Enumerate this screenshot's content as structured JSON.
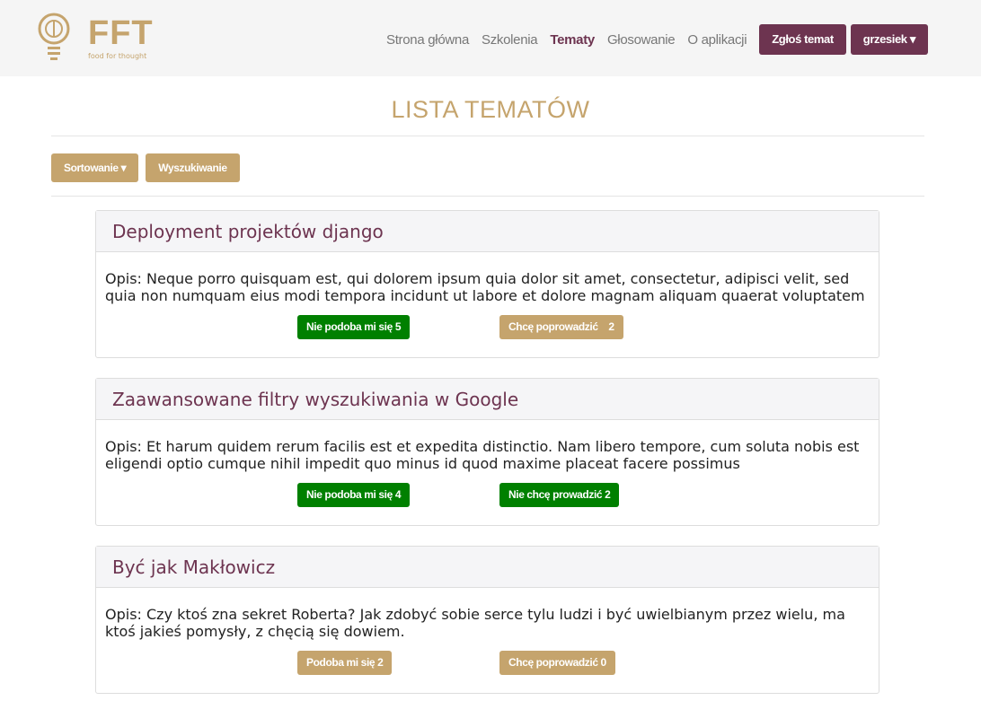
{
  "brand": {
    "name": "FFT",
    "tagline": "food for thought"
  },
  "nav": {
    "items": [
      "Strona główna",
      "Szkolenia",
      "Tematy",
      "Głosowanie",
      "O aplikacji"
    ],
    "active": "Tematy",
    "report_button": "Zgłoś temat",
    "user_button": "grzesiek"
  },
  "page": {
    "title": "LISTA TEMATÓW",
    "sort_button": "Sortowanie",
    "search_button": "Wyszukiwanie"
  },
  "colors": {
    "gold": "#c5a46d",
    "purple": "#6d3450",
    "green": "#008000"
  },
  "topics": [
    {
      "title": "Deployment projektów django",
      "desc": "Opis: Neque porro quisquam est, qui dolorem ipsum quia dolor sit amet, consectetur, adipisci velit, sed quia non numquam eius modi tempora incidunt ut labore et dolore magnam aliquam quaerat voluptatem",
      "like": "Nie podoba mi się 5",
      "lead": "Chcę poprowadzić    2",
      "like_color": "green",
      "lead_color": "gold"
    },
    {
      "title": "Zaawansowane filtry wyszukiwania w Google",
      "desc": "Opis: Et harum quidem rerum facilis est et expedita distinctio. Nam libero tempore, cum soluta nobis est eligendi optio cumque nihil impedit quo minus id quod maxime placeat facere possimus",
      "like": "Nie podoba mi się 4",
      "lead": "Nie chcę prowadzić 2",
      "like_color": "green",
      "lead_color": "green"
    },
    {
      "title": "Być jak Makłowicz",
      "desc": "Opis: Czy ktoś zna sekret Roberta? Jak zdobyć sobie serce tylu ludzi i być uwielbianym przez wielu, ma ktoś jakieś pomysły, z chęcią się dowiem.",
      "like": "Podoba mi się 2",
      "lead": "Chcę poprowadzić 0",
      "like_color": "gold",
      "lead_color": "gold"
    }
  ]
}
